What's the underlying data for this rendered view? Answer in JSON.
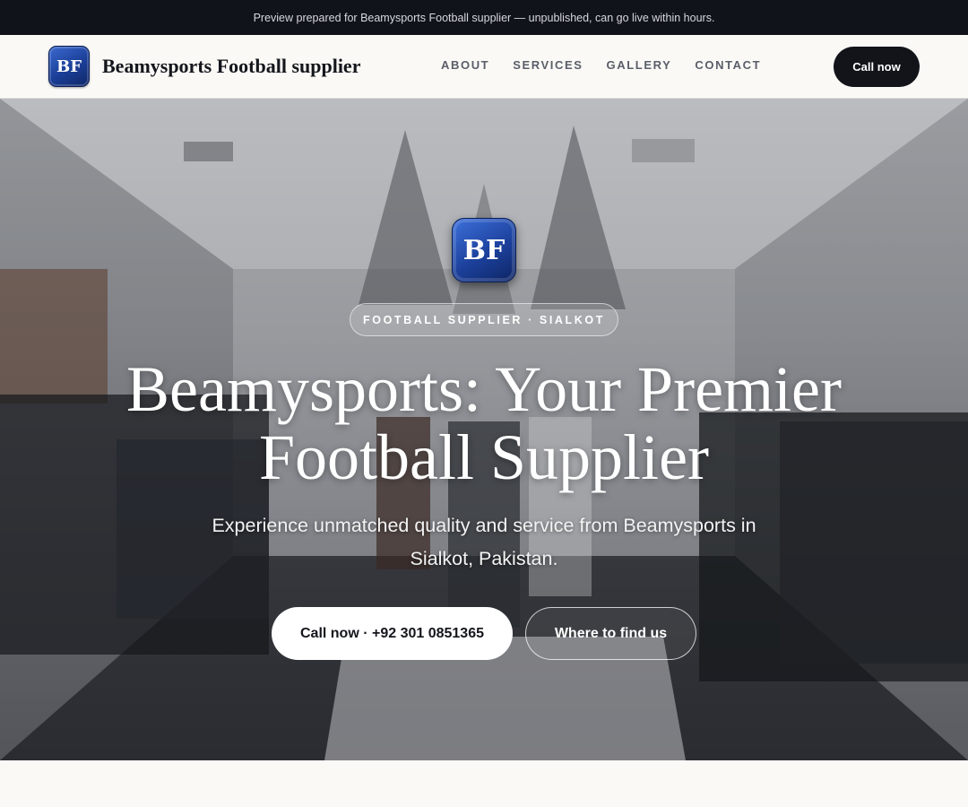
{
  "banner": {
    "text": "Preview prepared for Beamysports Football supplier — unpublished, can go live within hours."
  },
  "header": {
    "logo_text": "BF",
    "brand_name": "Beamysports Football supplier",
    "nav": [
      "ABOUT",
      "SERVICES",
      "GALLERY",
      "CONTACT"
    ],
    "cta_label": "Call now"
  },
  "hero": {
    "logo_text": "BF",
    "kicker": "FOOTBALL SUPPLIER · SIALKOT",
    "headline": "Beamysports: Your Premier Football Supplier",
    "subheadline": "Experience unmatched quality and service from Beamysports in Sialkot, Pakistan.",
    "primary_button": "Call now · +92 301 0851365",
    "secondary_button": "Where to find us"
  },
  "colors": {
    "banner_bg": "#10131a",
    "nav_bg": "#faf9f6",
    "cta_bg": "#12141a",
    "logo_blue": "#1c419c"
  }
}
